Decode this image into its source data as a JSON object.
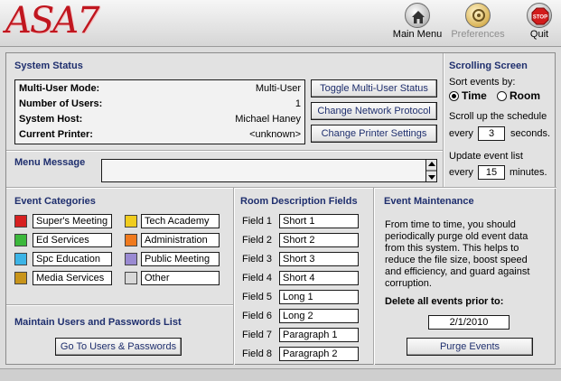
{
  "toolbar": {
    "logo": "ASA7",
    "main_menu_label": "Main Menu",
    "preferences_label": "Preferences",
    "quit_label": "Quit",
    "stop_text": "STOP"
  },
  "system_status": {
    "title": "System Status",
    "rows": [
      {
        "label": "Multi-User Mode:",
        "value": "Multi-User"
      },
      {
        "label": "Number of Users:",
        "value": "1"
      },
      {
        "label": "System Host:",
        "value": "Michael Haney"
      },
      {
        "label": "Current Printer:",
        "value": "<unknown>"
      }
    ],
    "buttons": {
      "toggle": "Toggle Multi-User Status",
      "network": "Change Network Protocol",
      "printer": "Change Printer Settings"
    }
  },
  "scrolling_screen": {
    "title": "Scrolling Screen",
    "sort_label": "Sort events by:",
    "time_label": "Time",
    "room_label": "Room",
    "selected": "Time",
    "scroll_text_1": "Scroll up the schedule",
    "every_label": "every",
    "seconds_value": "3",
    "seconds_label": "seconds.",
    "update_text": "Update event list",
    "minutes_value": "15",
    "minutes_label": "minutes."
  },
  "menu_message": {
    "title": "Menu Message",
    "value": ""
  },
  "event_categories": {
    "title": "Event Categories",
    "items": [
      {
        "label": "Super's Meeting",
        "color": "#d62020"
      },
      {
        "label": "Ed Services",
        "color": "#3cb83c"
      },
      {
        "label": "Spc Education",
        "color": "#3cb4e6"
      },
      {
        "label": "Media Services",
        "color": "#c8941a"
      },
      {
        "label": "Tech Academy",
        "color": "#f0cc1e"
      },
      {
        "label": "Administration",
        "color": "#f07a1e"
      },
      {
        "label": "Public Meeting",
        "color": "#9a8ad2"
      },
      {
        "label": "Other",
        "color": "#d8d8d8"
      }
    ]
  },
  "users": {
    "title": "Maintain Users and Passwords List",
    "button": "Go To Users & Passwords"
  },
  "room_fields": {
    "title": "Room Description Fields",
    "items": [
      {
        "label": "Field 1",
        "value": "Short 1"
      },
      {
        "label": "Field 2",
        "value": "Short 2"
      },
      {
        "label": "Field 3",
        "value": "Short 3"
      },
      {
        "label": "Field 4",
        "value": "Short 4"
      },
      {
        "label": "Field 5",
        "value": "Long 1"
      },
      {
        "label": "Field 6",
        "value": "Long 2"
      },
      {
        "label": "Field 7",
        "value": "Paragraph 1"
      },
      {
        "label": "Field 8",
        "value": "Paragraph 2"
      }
    ]
  },
  "maintenance": {
    "title": "Event Maintenance",
    "lines": [
      "From time to time, you should",
      "periodically purge old event data",
      "from this system.  This helps to",
      "reduce the file size, boost speed",
      "and efficiency, and guard against",
      "corruption."
    ],
    "delete_label": "Delete all events prior to:",
    "date": "2/1/2010",
    "purge_button": "Purge Events"
  }
}
